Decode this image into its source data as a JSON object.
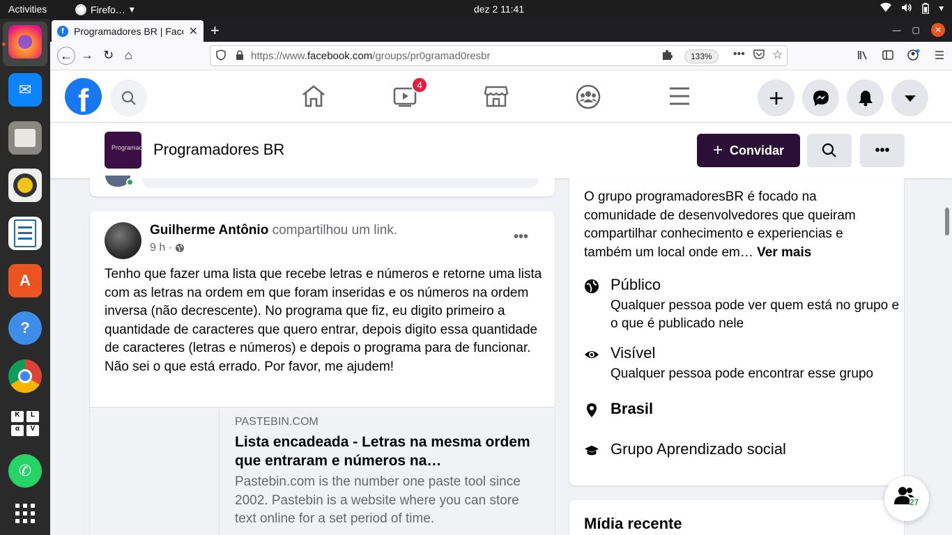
{
  "system": {
    "activities": "Activities",
    "app_name": "Firefo…",
    "app_caret": "▾",
    "clock": "dez 2  11:41",
    "tray": {
      "wifi": "▾",
      "volume": "◀)",
      "battery": "▮",
      "menu": "▾"
    }
  },
  "dock": {
    "items": [
      "firefox",
      "thunderbird",
      "files",
      "rhythmbox",
      "libreoffice-writer",
      "software",
      "help",
      "chrome",
      "keyboard",
      "whatsapp",
      "show-apps"
    ]
  },
  "browser": {
    "tab_title": "Programadores BR | Face",
    "tab_favicon": "f",
    "tab_close": "✕",
    "new_tab": "+",
    "win_min": "—",
    "win_max": "▢",
    "win_close": "✕",
    "url_prefix": "https://www.",
    "url_domain": "facebook.com",
    "url_path": "/groups/pr0gramad0resbr",
    "zoom": "133%",
    "nav_back": "←",
    "nav_forward": "→",
    "nav_reload": "↻",
    "nav_home": "⌂"
  },
  "fb": {
    "logo": "f",
    "video_badge": "4",
    "colors": {
      "brand": "#1877f2",
      "invite_bg": "#2b0f37",
      "badge": "#e41e3f"
    }
  },
  "group": {
    "thumb_text": "Programad",
    "name": "Programadores BR",
    "invite_label": "Convidar",
    "invite_icon": "+"
  },
  "post": {
    "author": "Guilherme Antônio",
    "action": " compartilhou um link.",
    "time": "9 h ·",
    "more": "•••",
    "text": "Tenho que fazer uma lista que recebe letras e números e retorne uma lista com as letras na ordem em que foram inseridas e os números na ordem inversa (não decrescente). No programa que fiz, eu digito primeiro a quantidade de caracteres que quero entrar, depois digito essa quantidade de caracteres (letras e números) e depois o programa para de funcionar. Não sei o que está errado. Por favor, me ajudem!",
    "link": {
      "source": "PASTEBIN.COM",
      "title": "Lista encadeada - Letras na mesma ordem que entraram e números na…",
      "description": "Pastebin.com is the number one paste tool since 2002. Pastebin is a website where you can store text online for a set period of time."
    }
  },
  "about": {
    "description": "O grupo programadoresBR é focado na comunidade de desenvolvedores que queiram compartilhar conhecimento e experiencias e também um local onde em…",
    "see_more": "Ver mais",
    "items": [
      {
        "icon": "globe-icon",
        "title": "Público",
        "subtitle": "Qualquer pessoa pode ver quem está no grupo e o que é publicado nele"
      },
      {
        "icon": "eye-icon",
        "title": "Visível",
        "subtitle": "Qualquer pessoa pode encontrar esse grupo"
      },
      {
        "icon": "location-pin-icon",
        "title": "Brasil",
        "subtitle": ""
      },
      {
        "icon": "graduation-cap-icon",
        "title": "Grupo Aprendizado social",
        "subtitle": ""
      }
    ]
  },
  "recent_media": {
    "title": "Mídia recente"
  },
  "chat": {
    "online_count": "27"
  }
}
